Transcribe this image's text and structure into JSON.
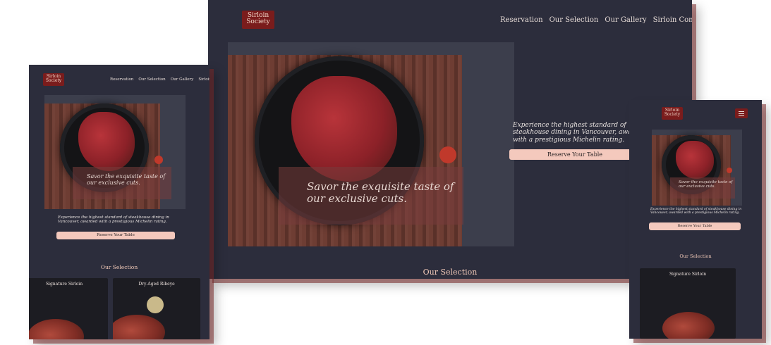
{
  "brand": {
    "line1": "Sirloin",
    "line2": "Society"
  },
  "nav": [
    "Reservation",
    "Our Selection",
    "Our Gallery",
    "Sirloin Contact"
  ],
  "menu_icon": "hamburger-icon",
  "hero": {
    "tagline": "Savor the exquisite taste of our exclusive cuts."
  },
  "intro": "Experience the highest standard of steakhouse dining in Vancouver, awarded with a prestigious Michelin rating.",
  "cta": "Reserve Your Table",
  "selection": {
    "title": "Our Selection",
    "cards": [
      {
        "name": "Signature Sirloin"
      },
      {
        "name": "Dry-Aged Ribeye"
      }
    ]
  },
  "colors": {
    "page": "#2c2d3c",
    "brand": "#7a1c1c",
    "button": "#f4c9bd",
    "accent_text": "#f1c9b8"
  }
}
